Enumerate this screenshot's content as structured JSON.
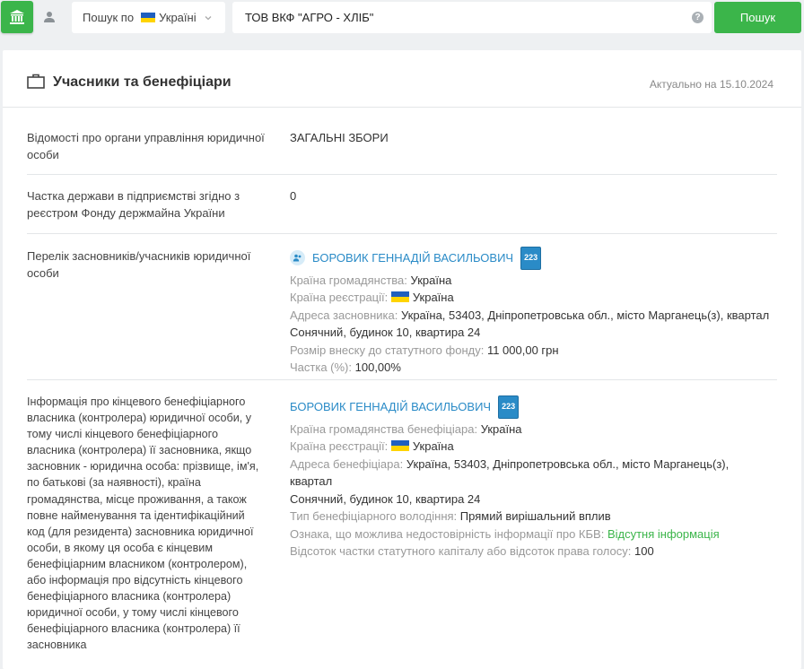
{
  "topbar": {
    "scope_label": "Пошук по",
    "scope_value": "Україні",
    "search_value": "ТОВ ВКФ \"АГРО - ХЛІБ\"",
    "help": "?",
    "search_button": "Пошук"
  },
  "card": {
    "title": "Учасники та бенефіціари",
    "actual": "Актуально на 15.10.2024",
    "rows": [
      {
        "label": "Відомості про органи управління юридичної особи",
        "value": "ЗАГАЛЬНІ ЗБОРИ"
      },
      {
        "label": "Частка держави в підприємстві згідно з реєстром Фонду держмайна України",
        "value": "0"
      }
    ],
    "founders": {
      "label": "Перелік засновників/учасників юридичної особи",
      "name": "БОРОВИК ГЕННАДІЙ ВАСИЛЬОВИЧ",
      "badge": "223",
      "citizenship_label": "Країна громадянства:",
      "citizenship": "Україна",
      "reg_country_label": "Країна реєстрації:",
      "reg_country": "Україна",
      "address_label": "Адреса засновника:",
      "address_line1": "Україна, 53403, Дніпропетровська обл., місто Марганець(з), квартал",
      "address_line2": "Сонячний, будинок 10, квартира 24",
      "contribution_label": "Розмір внеску до статутного фонду:",
      "contribution": "11 000,00 грн",
      "share_label": "Частка (%):",
      "share": "100,00%"
    },
    "beneficiary": {
      "label_lines": [
        "Інформація про кінцевого бенефіціарного",
        "власника (контролера) юридичної особи, у",
        "тому числі кінцевого бенефіціарного",
        "власника (контролера) її засновника, якщо",
        "засновник - юридична особа: прізвище, ім'я,",
        "по батькові (за наявності), країна",
        "громадянства, місце проживання, а також",
        "повне найменування та ідентифікаційний",
        "код (для резидента) засновника юридичної",
        "особи, в якому ця особа є кінцевим",
        "бенефіціарним власником (контролером),",
        "або інформація про відсутність кінцевого",
        "бенефіціарного власника (контролера)",
        "юридичної особи, у тому числі кінцевого",
        "бенефіціарного власника (контролера) її",
        "засновника"
      ],
      "name": "БОРОВИК ГЕННАДІЙ ВАСИЛЬОВИЧ",
      "badge": "223",
      "citizenship_label": "Країна громадянства бенефіціара:",
      "citizenship": "Україна",
      "reg_country_label": "Країна реєстрації:",
      "reg_country": "Україна",
      "address_label": "Адреса бенефіціара:",
      "address_line1": "Україна, 53403, Дніпропетровська обл., місто Марганець(з), квартал",
      "address_line2": "Сонячний, будинок 10, квартира 24",
      "ownership_label": "Тип бенефіціарного володіння:",
      "ownership": "Прямий вирішальний вплив",
      "unreliable_label": "Ознака, що можлива недостовірність інформації про КБВ:",
      "unreliable": "Відсутня інформація",
      "percent_label": "Відсоток частки статутного капіталу або відсоток права голосу:",
      "percent": "100"
    }
  },
  "colors": {
    "green": "#3bb54a",
    "link": "#2a8bc7"
  }
}
